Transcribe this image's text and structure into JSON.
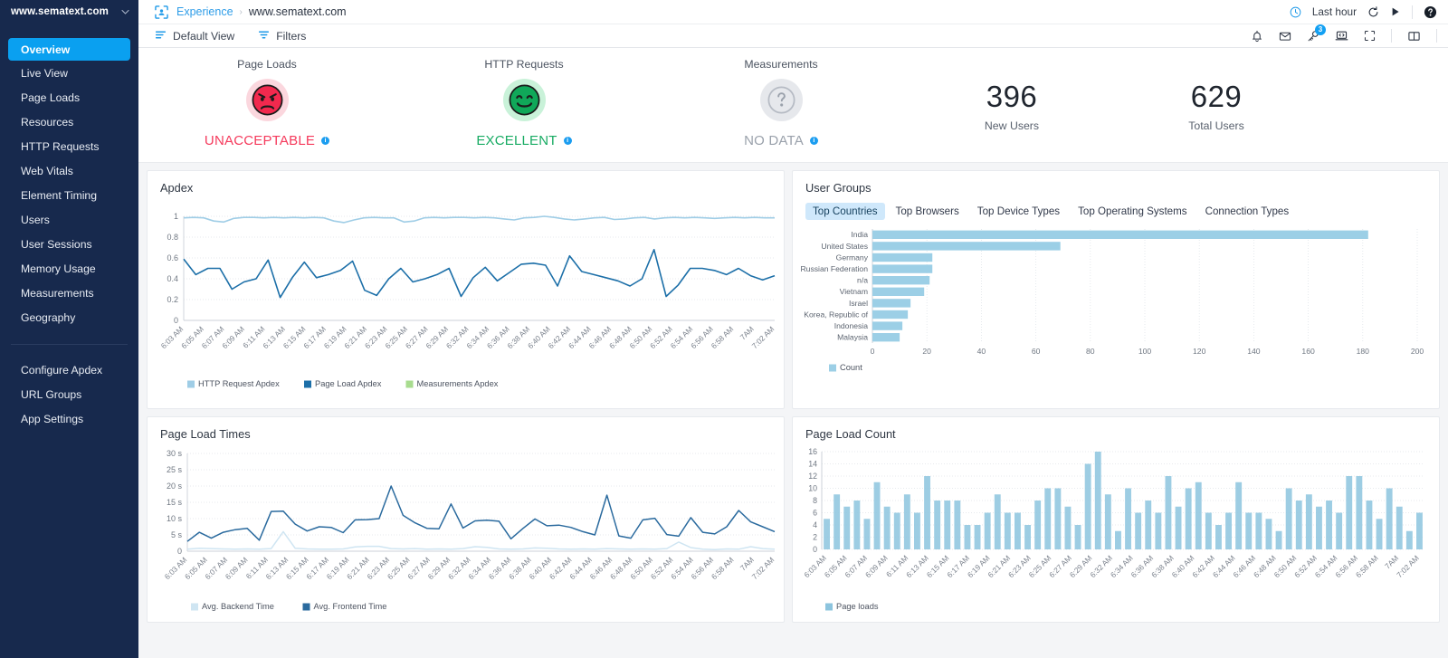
{
  "sidebar": {
    "brand": "www.sematext.com",
    "caret_icon": "chevron-down-icon",
    "items": [
      {
        "label": "Overview",
        "active": true
      },
      {
        "label": "Live View",
        "active": false
      },
      {
        "label": "Page Loads",
        "active": false
      },
      {
        "label": "Resources",
        "active": false
      },
      {
        "label": "HTTP Requests",
        "active": false
      },
      {
        "label": "Web Vitals",
        "active": false
      },
      {
        "label": "Element Timing",
        "active": false
      },
      {
        "label": "Users",
        "active": false
      },
      {
        "label": "User Sessions",
        "active": false
      },
      {
        "label": "Memory Usage",
        "active": false
      },
      {
        "label": "Measurements",
        "active": false
      },
      {
        "label": "Geography",
        "active": false
      }
    ],
    "footer_items": [
      {
        "label": "Configure Apdex"
      },
      {
        "label": "URL Groups"
      },
      {
        "label": "App Settings"
      }
    ],
    "bg_color": "#17294d",
    "active_color": "#0aa0f0"
  },
  "topbar": {
    "logo_icon": "experience-scan-icon",
    "breadcrumb_root": "Experience",
    "breadcrumb_sep": "›",
    "breadcrumb_current": "www.sematext.com",
    "time_range": "Last hour",
    "clock_icon": "clock-icon",
    "refresh_icon": "refresh-icon",
    "play_icon": "play-icon",
    "help_icon": "help-circle-icon"
  },
  "subbar": {
    "default_view_label": "Default View",
    "default_view_icon": "view-list-icon",
    "filters_label": "Filters",
    "filters_icon": "filter-icon",
    "alerts_icon": "bell-icon",
    "mail_icon": "mail-icon",
    "key_icon": "key-icon",
    "key_badge_count": "3",
    "console_icon": "laptop-code-icon",
    "fullscreen_icon": "fullscreen-icon",
    "split_icon": "split-pane-icon"
  },
  "kpis": [
    {
      "title": "Page Loads",
      "status": "UNACCEPTABLE",
      "face": "angry-face-icon",
      "color": "#f53a5c",
      "bg": "#fbd7de",
      "info_icon": "info-icon"
    },
    {
      "title": "HTTP Requests",
      "status": "EXCELLENT",
      "face": "happy-face-icon",
      "color": "#18ab63",
      "bg": "#c9f2d9",
      "info_icon": "info-icon"
    },
    {
      "title": "Measurements",
      "status": "NO DATA",
      "face": "question-face-icon",
      "color": "#9aa1ab",
      "bg": "#e6e8ec",
      "info_icon": "info-icon"
    }
  ],
  "kpi_numbers": [
    {
      "value": "396",
      "label": "New Users"
    },
    {
      "value": "629",
      "label": "Total Users"
    }
  ],
  "panels": {
    "apdex_title": "Apdex",
    "user_groups_title": "User Groups",
    "page_load_times_title": "Page Load Times",
    "page_load_count_title": "Page Load Count",
    "user_groups_tabs": [
      {
        "label": "Top Countries",
        "active": true
      },
      {
        "label": "Top Browsers",
        "active": false
      },
      {
        "label": "Top Device Types",
        "active": false
      },
      {
        "label": "Top Operating Systems",
        "active": false
      },
      {
        "label": "Connection Types",
        "active": false
      }
    ]
  },
  "chart_data": [
    {
      "id": "apdex",
      "type": "line",
      "title": "Apdex",
      "xlabel": "",
      "ylabel": "",
      "ylim": [
        0,
        1
      ],
      "yticks": [
        "0",
        "0.2",
        "0.4",
        "0.6",
        "0.8",
        "1"
      ],
      "grid": true,
      "legend_position": "bottom",
      "x": [
        "6:03 AM",
        "6:05 AM",
        "6:07 AM",
        "6:09 AM",
        "6:11 AM",
        "6:13 AM",
        "6:15 AM",
        "6:17 AM",
        "6:19 AM",
        "6:21 AM",
        "6:23 AM",
        "6:25 AM",
        "6:27 AM",
        "6:29 AM",
        "6:32 AM",
        "6:34 AM",
        "6:36 AM",
        "6:38 AM",
        "6:40 AM",
        "6:42 AM",
        "6:44 AM",
        "6:46 AM",
        "6:48 AM",
        "6:50 AM",
        "6:52 AM",
        "6:54 AM",
        "6:56 AM",
        "6:58 AM",
        "7AM",
        "7:02 AM"
      ],
      "series": [
        {
          "name": "HTTP Request Apdex",
          "color": "#9fcde6",
          "values": [
            0.985,
            0.99,
            0.985,
            0.955,
            0.945,
            0.98,
            0.99,
            0.99,
            0.985,
            0.99,
            0.985,
            0.99,
            0.985,
            0.99,
            0.985,
            0.955,
            0.94,
            0.965,
            0.985,
            0.99,
            0.985,
            0.985,
            0.945,
            0.955,
            0.985,
            0.99,
            0.985,
            0.99,
            0.99,
            0.985,
            0.99,
            0.985,
            0.975,
            0.965,
            0.985,
            0.99,
            1.0,
            0.99,
            0.975,
            0.965,
            0.975,
            0.985,
            0.99,
            0.97,
            0.975,
            0.985,
            0.99,
            0.975,
            0.985,
            0.99,
            0.985,
            0.99,
            0.985,
            0.98,
            0.985,
            0.99,
            0.985,
            0.99,
            0.985,
            0.985
          ]
        },
        {
          "name": "Page Load Apdex",
          "color": "#1c6fa8",
          "values": [
            0.59,
            0.44,
            0.5,
            0.5,
            0.3,
            0.37,
            0.4,
            0.58,
            0.22,
            0.41,
            0.56,
            0.41,
            0.44,
            0.48,
            0.57,
            0.29,
            0.24,
            0.4,
            0.5,
            0.37,
            0.4,
            0.44,
            0.5,
            0.23,
            0.41,
            0.51,
            0.38,
            0.46,
            0.54,
            0.55,
            0.53,
            0.33,
            0.62,
            0.47,
            0.44,
            0.41,
            0.38,
            0.33,
            0.4,
            0.68,
            0.23,
            0.34,
            0.5,
            0.5,
            0.48,
            0.44,
            0.5,
            0.43,
            0.39,
            0.43
          ]
        },
        {
          "name": "Measurements Apdex",
          "color": "#a8dc8f",
          "values": []
        }
      ]
    },
    {
      "id": "user-groups",
      "type": "bar",
      "orientation": "horizontal",
      "title": "User Groups",
      "xlabel": "",
      "ylabel": "",
      "xlim": [
        0,
        200
      ],
      "xticks": [
        0,
        20,
        40,
        60,
        80,
        100,
        120,
        140,
        160,
        180,
        200
      ],
      "grid": true,
      "legend_position": "bottom",
      "legend_entries": [
        "Count"
      ],
      "bar_color": "#9ccfe6",
      "categories": [
        "India",
        "United States",
        "Germany",
        "Russian Federation",
        "n/a",
        "Vietnam",
        "Israel",
        "Korea, Republic of",
        "Indonesia",
        "Malaysia"
      ],
      "values": [
        182,
        69,
        22,
        22,
        21,
        19,
        14,
        13,
        11,
        10
      ]
    },
    {
      "id": "page-load-times",
      "type": "line",
      "title": "Page Load Times",
      "xlabel": "",
      "ylabel": "",
      "ylim": [
        0,
        30
      ],
      "yticks": [
        "0",
        "5 s",
        "10 s",
        "15 s",
        "20 s",
        "25 s",
        "30 s"
      ],
      "grid": true,
      "legend_position": "bottom",
      "x": [
        "6:03 AM",
        "6:05 AM",
        "6:07 AM",
        "6:09 AM",
        "6:11 AM",
        "6:13 AM",
        "6:15 AM",
        "6:17 AM",
        "6:19 AM",
        "6:21 AM",
        "6:23 AM",
        "6:25 AM",
        "6:27 AM",
        "6:29 AM",
        "6:32 AM",
        "6:34 AM",
        "6:36 AM",
        "6:38 AM",
        "6:40 AM",
        "6:42 AM",
        "6:44 AM",
        "6:46 AM",
        "6:48 AM",
        "6:50 AM",
        "6:52 AM",
        "6:54 AM",
        "6:56 AM",
        "6:58 AM",
        "7AM",
        "7:02 AM"
      ],
      "series": [
        {
          "name": "Avg. Backend Time",
          "color": "#cfe5f2",
          "values": [
            0.6,
            0.9,
            0.8,
            0.7,
            0.6,
            0.7,
            0.6,
            0.8,
            6.0,
            0.9,
            0.7,
            0.6,
            0.6,
            0.7,
            1.3,
            1.5,
            1.5,
            0.8,
            0.7,
            0.8,
            0.6,
            0.7,
            0.6,
            0.8,
            1.4,
            1.2,
            0.7,
            0.6,
            0.7,
            1.0,
            0.9,
            0.7,
            0.6,
            0.7,
            0.6,
            0.8,
            0.7,
            0.6,
            0.7,
            0.6,
            0.8,
            2.8,
            1.1,
            0.6,
            0.5,
            0.7,
            0.6,
            1.4,
            0.8,
            0.6
          ]
        },
        {
          "name": "Avg. Frontend Time",
          "color": "#2a6a9e",
          "values": [
            3.0,
            5.8,
            4.0,
            5.8,
            6.6,
            7.0,
            3.4,
            12.2,
            12.3,
            8.3,
            6.2,
            7.5,
            7.3,
            5.7,
            9.6,
            9.7,
            10.0,
            20.0,
            11.0,
            8.7,
            7.0,
            6.9,
            14.5,
            7.1,
            9.3,
            9.5,
            9.2,
            3.8,
            7.0,
            9.9,
            7.8,
            8.0,
            7.3,
            6.0,
            5.0,
            17.2,
            4.7,
            4.0,
            9.6,
            10.1,
            5.1,
            4.6,
            10.3,
            5.8,
            5.3,
            7.5,
            12.5,
            9.0,
            7.5,
            6.0
          ]
        }
      ]
    },
    {
      "id": "page-load-count",
      "type": "bar",
      "orientation": "vertical",
      "title": "Page Load Count",
      "xlabel": "",
      "ylabel": "",
      "ylim": [
        0,
        16
      ],
      "yticks": [
        0,
        2,
        4,
        6,
        8,
        10,
        12,
        14,
        16
      ],
      "grid": true,
      "legend_position": "bottom",
      "legend_entries": [
        "Page loads"
      ],
      "bar_color": "#8cc4de",
      "x": [
        "6:03 AM",
        "6:05 AM",
        "6:07 AM",
        "6:09 AM",
        "6:11 AM",
        "6:13 AM",
        "6:15 AM",
        "6:17 AM",
        "6:19 AM",
        "6:21 AM",
        "6:23 AM",
        "6:25 AM",
        "6:27 AM",
        "6:29 AM",
        "6:32 AM",
        "6:34 AM",
        "6:36 AM",
        "6:38 AM",
        "6:40 AM",
        "6:42 AM",
        "6:44 AM",
        "6:46 AM",
        "6:48 AM",
        "6:50 AM",
        "6:52 AM",
        "6:54 AM",
        "6:56 AM",
        "6:58 AM",
        "7AM",
        "7:02 AM"
      ],
      "values": [
        5,
        9,
        7,
        8,
        5,
        11,
        7,
        6,
        9,
        6,
        12,
        8,
        8,
        8,
        4,
        4,
        6,
        9,
        6,
        6,
        4,
        8,
        10,
        10,
        7,
        4,
        14,
        16,
        9,
        3,
        10,
        6,
        8,
        6,
        12,
        7,
        10,
        11,
        6,
        4,
        6,
        11,
        6,
        6,
        5,
        3,
        10,
        8,
        9,
        7,
        8,
        6,
        12,
        12,
        8,
        5,
        10,
        7,
        3,
        6
      ]
    }
  ]
}
